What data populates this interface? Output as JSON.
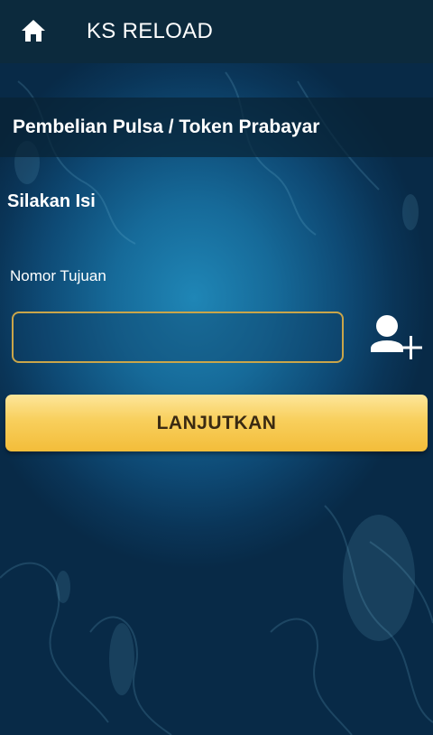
{
  "header": {
    "title": "KS RELOAD",
    "home_icon": "home-icon"
  },
  "section": {
    "title": "Pembelian Pulsa / Token Prabayar"
  },
  "form": {
    "instruction": "Silakan Isi",
    "phone_label": "Nomor Tujuan",
    "phone_value": "",
    "contact_icon": "add-contact-icon",
    "submit_label": "LANJUTKAN"
  },
  "colors": {
    "topbar": "#0c2a3d",
    "background_center": "#1f86b6",
    "background_edge": "#082a47",
    "input_border": "#c9a54a",
    "button_top": "#fde69a",
    "button_bottom": "#f3bd3a",
    "button_text": "#3a2a12"
  }
}
